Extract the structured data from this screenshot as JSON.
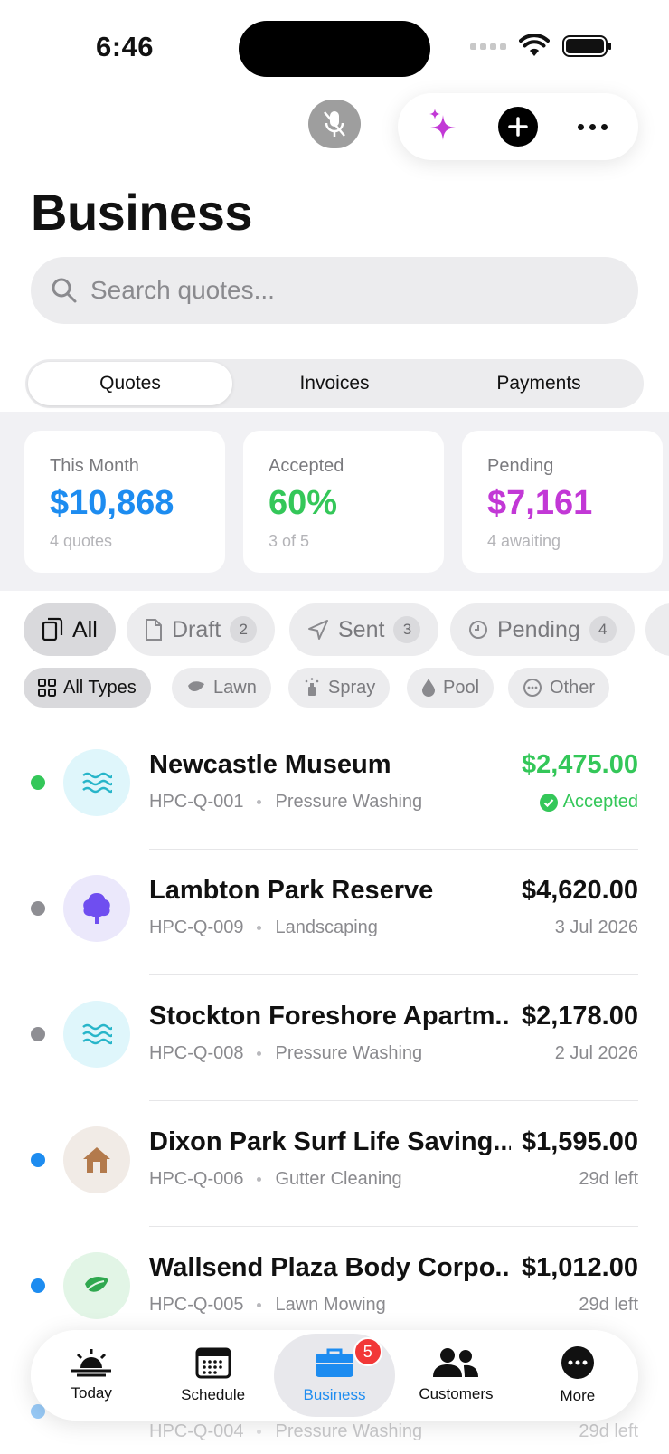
{
  "status_bar": {
    "time": "6:46"
  },
  "page": {
    "title": "Business"
  },
  "search": {
    "placeholder": "Search quotes..."
  },
  "segments": [
    {
      "label": "Quotes",
      "active": true
    },
    {
      "label": "Invoices",
      "active": false
    },
    {
      "label": "Payments",
      "active": false
    }
  ],
  "stats": [
    {
      "label": "This Month",
      "value": "$10,868",
      "sub": "4 quotes",
      "color": "#1d8cf0"
    },
    {
      "label": "Accepted",
      "value": "60%",
      "sub": "3 of 5",
      "color": "#34c759"
    },
    {
      "label": "Pending",
      "value": "$7,161",
      "sub": "4 awaiting",
      "color": "#c238d6"
    }
  ],
  "filters": [
    {
      "label": "All",
      "count": "",
      "icon": "documents-icon",
      "active": true
    },
    {
      "label": "Draft",
      "count": "2",
      "icon": "document-icon",
      "active": false
    },
    {
      "label": "Sent",
      "count": "3",
      "icon": "send-icon",
      "active": false
    },
    {
      "label": "Pending",
      "count": "4",
      "icon": "clock-icon",
      "active": false
    }
  ],
  "types": [
    {
      "label": "All Types",
      "icon": "grid-icon",
      "active": true
    },
    {
      "label": "Lawn",
      "icon": "leaf-icon",
      "active": false
    },
    {
      "label": "Spray",
      "icon": "sprayer-icon",
      "active": false
    },
    {
      "label": "Pool",
      "icon": "drop-icon",
      "active": false
    },
    {
      "label": "Other",
      "icon": "more-circle-icon",
      "active": false
    }
  ],
  "quotes": [
    {
      "name": "Newcastle Museum",
      "code": "HPC-Q-001",
      "service": "Pressure Washing",
      "amount": "$2,475.00",
      "status": "Accepted",
      "dot_color": "#34c759",
      "amount_color": "#34c759",
      "icon": "waves-icon",
      "icon_bg": "#dff6fb"
    },
    {
      "name": "Lambton Park Reserve",
      "code": "HPC-Q-009",
      "service": "Landscaping",
      "amount": "$4,620.00",
      "status": "3 Jul 2026",
      "dot_color": "#8e8e93",
      "amount_color": "#111111",
      "icon": "tree-icon",
      "icon_bg": "#ebe8fb"
    },
    {
      "name": "Stockton Foreshore Apartm...",
      "code": "HPC-Q-008",
      "service": "Pressure Washing",
      "amount": "$2,178.00",
      "status": "2 Jul 2026",
      "dot_color": "#8e8e93",
      "amount_color": "#111111",
      "icon": "waves-icon",
      "icon_bg": "#dff6fb"
    },
    {
      "name": "Dixon Park Surf Life Saving...",
      "code": "HPC-Q-006",
      "service": "Gutter Cleaning",
      "amount": "$1,595.00",
      "status": "29d left",
      "dot_color": "#1d8cf0",
      "amount_color": "#111111",
      "icon": "house-icon",
      "icon_bg": "#f1ebe6"
    },
    {
      "name": "Wallsend Plaza Body Corpo...",
      "code": "HPC-Q-005",
      "service": "Lawn Mowing",
      "amount": "$1,012.00",
      "status": "29d left",
      "dot_color": "#1d8cf0",
      "amount_color": "#111111",
      "icon": "leaf-icon",
      "icon_bg": "#e2f5e6"
    }
  ],
  "partial_row": {
    "code": "HPC-Q-004",
    "service": "Pressure Washing",
    "status": "29d left"
  },
  "tabbar": [
    {
      "label": "Today",
      "icon": "sunrise-icon",
      "active": false,
      "badge": ""
    },
    {
      "label": "Schedule",
      "icon": "calendar-icon",
      "active": false,
      "badge": ""
    },
    {
      "label": "Business",
      "icon": "briefcase-icon",
      "active": true,
      "badge": "5"
    },
    {
      "label": "Customers",
      "icon": "people-icon",
      "active": false,
      "badge": ""
    },
    {
      "label": "More",
      "icon": "more-icon",
      "active": false,
      "badge": ""
    }
  ]
}
